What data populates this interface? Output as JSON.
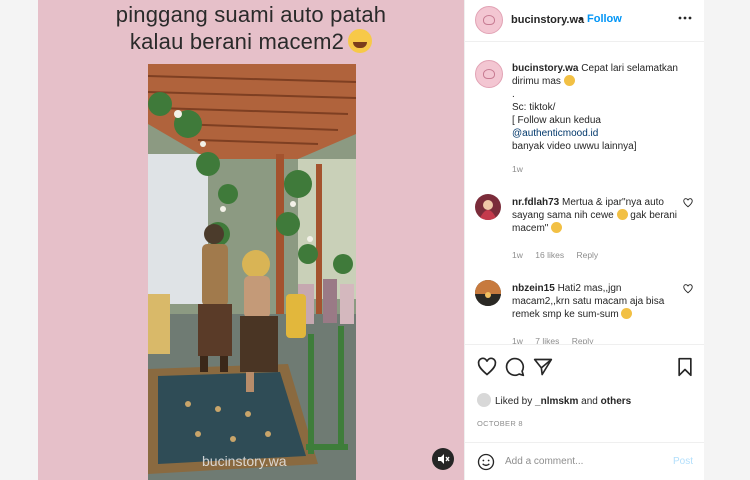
{
  "media": {
    "caption_line1": "pinggang suami auto patah",
    "caption_line2": "kalau berani macem2",
    "caption_emoji": "laughing-crying-emoji",
    "watermark": "bucinstory.wa",
    "sound_icon": "speaker-muted-icon",
    "background_color": "#e6c0c9"
  },
  "header": {
    "username": "bucinstory.wa",
    "separator": "•",
    "follow_label": "Follow",
    "more_label": "•••"
  },
  "caption": {
    "username": "bucinstory.wa",
    "text1": "Cepat lari selamatkan dirimu mas",
    "text2": ".",
    "text3": "Sc: tiktok/",
    "text4": "[ Follow akun kedua",
    "mention": "@authenticmood.id",
    "text5": "banyak video uwwu lainnya]",
    "time": "1w"
  },
  "comments": [
    {
      "username": "nr.fdlah73",
      "text": "Mertua & ipar\"nya auto sayang sama nih cewe",
      "text_after": "gak berani macem\"",
      "time": "1w",
      "likes": "16 likes",
      "reply": "Reply"
    },
    {
      "username": "nbzein15",
      "text": "Hati2 mas,,jgn macam2,,krn satu macam aja bisa remek smp ke sum-sum",
      "time": "1w",
      "likes": "7 likes",
      "reply": "Reply"
    }
  ],
  "actions": {
    "like_icon": "heart-icon",
    "comment_icon": "comment-icon",
    "share_icon": "paper-plane-icon",
    "save_icon": "bookmark-icon",
    "liked_by_prefix": "Liked by",
    "liked_by_user": "_nlmskm",
    "liked_by_and": "and",
    "liked_by_others": "others",
    "date": "OCTOBER 8"
  },
  "add_comment": {
    "placeholder": "Add a comment...",
    "post_label": "Post",
    "emoji_icon": "smiley-icon"
  },
  "colors": {
    "accent": "#0095f6",
    "text": "#262626",
    "muted": "#8e8e8e",
    "post_disabled": "#b2dffc"
  }
}
